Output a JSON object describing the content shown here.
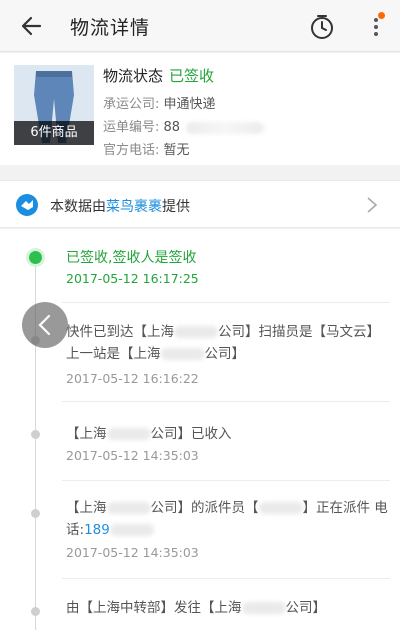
{
  "header": {
    "title": "物流详情",
    "back_icon": "back-arrow-icon",
    "timer_icon": "timer-icon",
    "more_icon": "more-vertical-icon",
    "notification_color": "#ff6a00"
  },
  "summary": {
    "item_count_label": "6件商品",
    "status_label": "物流状态",
    "status_value": "已签收",
    "carrier_label": "承运公司:",
    "carrier_value": "申通快递",
    "waybill_label": "运单编号:",
    "waybill_value": "88",
    "phone_label": "官方电话:",
    "phone_value": "暂无"
  },
  "source": {
    "prefix": "本数据由",
    "brand": "菜鸟裹裹",
    "suffix": "提供",
    "icon": "cainiao-logo-icon"
  },
  "timeline": [
    {
      "text": "已签收,签收人是签收",
      "time": "2017-05-12 16:17:25",
      "active": true
    },
    {
      "text_a": "快件已到达【上海",
      "text_b": "公司】扫描员是【马文云】上一站是【上海",
      "text_c": "公司】",
      "time": "2017-05-12 16:16:22"
    },
    {
      "text_a": "【上海",
      "text_b": "公司】已收入",
      "time": "2017-05-12 14:35:03"
    },
    {
      "text_a": "【上海",
      "text_b": "公司】的派件员【",
      "text_c": "】正在派件 电话:",
      "phone": "189",
      "time": "2017-05-12 14:35:03"
    },
    {
      "text_a": "由【上海中转部】发往【上海",
      "text_b": "公司】"
    }
  ],
  "colors": {
    "accent_green": "#22a53a",
    "link_blue": "#1a8ee0"
  }
}
